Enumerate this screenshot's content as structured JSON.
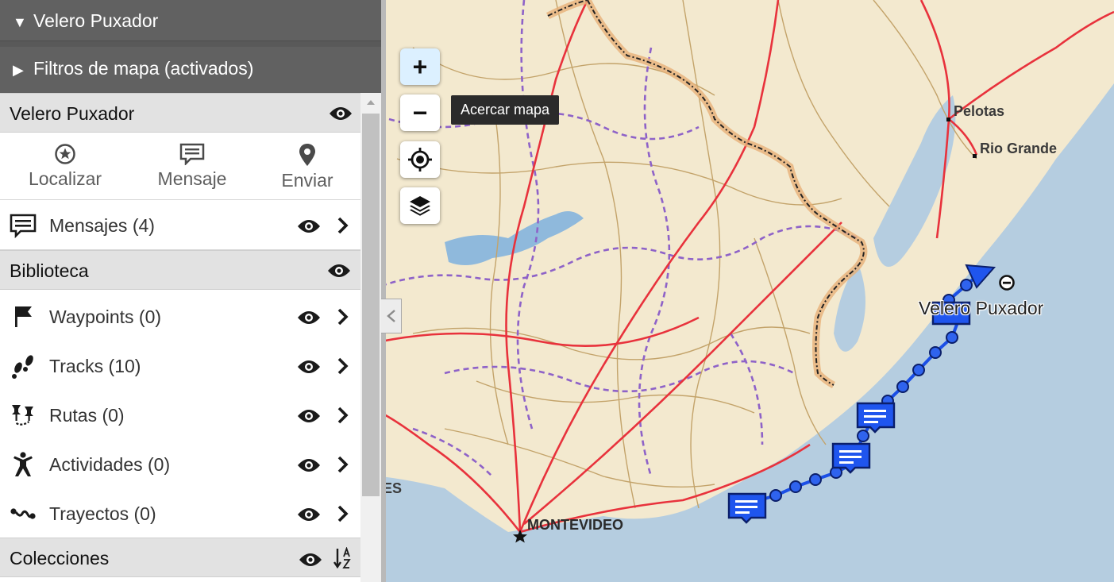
{
  "panel": {
    "header_title": "Velero Puxador",
    "filters_title": "Filtros de mapa (activados)",
    "device": {
      "name": "Velero Puxador",
      "actions": [
        {
          "label": "Localizar",
          "icon": "star-circle-icon"
        },
        {
          "label": "Mensaje",
          "icon": "message-icon"
        },
        {
          "label": "Enviar",
          "icon": "map-pin-icon"
        }
      ],
      "messages_label": "Mensajes (4)"
    },
    "library": {
      "title": "Biblioteca",
      "items": [
        {
          "label": "Waypoints (0)",
          "icon": "flag-icon"
        },
        {
          "label": "Tracks (10)",
          "icon": "footprints-icon"
        },
        {
          "label": "Rutas (0)",
          "icon": "route-pins-icon"
        },
        {
          "label": "Actividades (0)",
          "icon": "person-activity-icon"
        },
        {
          "label": "Trayectos (0)",
          "icon": "trip-squiggle-icon"
        }
      ]
    },
    "collections": {
      "title": "Colecciones",
      "sort_icon": "sort-az-icon"
    }
  },
  "map": {
    "zoom_in_label": "+",
    "zoom_out_label": "−",
    "tooltip": "Acercar mapa",
    "labels": {
      "pelotas": "Pelotas",
      "rio_grande": "Rio Grande",
      "montevideo": "MONTEVIDEO",
      "edge_fragment": "ES",
      "boat": "Velero Puxador"
    },
    "colors": {
      "land": "#f3e9cf",
      "sea": "#b5cde0",
      "track": "#1b4fe6",
      "highway": "#e8323c",
      "border": "#8e62c8"
    }
  }
}
